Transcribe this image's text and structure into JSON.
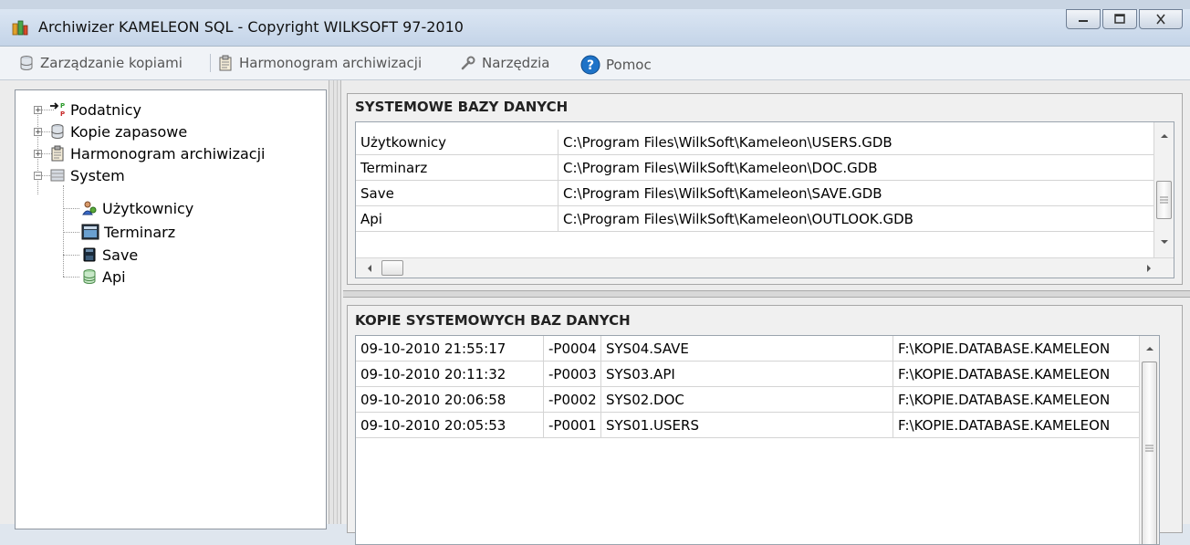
{
  "window": {
    "title": "Archiwizer KAMELEON SQL - Copyright WILKSOFT 97-2010"
  },
  "menu": {
    "items": [
      {
        "label": "Zarządzanie kopiami",
        "icon": "database-icon"
      },
      {
        "label": "Harmonogram archiwizacji",
        "icon": "clipboard-icon"
      },
      {
        "label": "Narzędzia",
        "icon": "wrench-icon"
      },
      {
        "label": "Pomoc",
        "icon": "help-icon"
      }
    ]
  },
  "tree": {
    "nodes": [
      {
        "label": "Podatnicy",
        "icon": "arrows-icon",
        "expander": "+"
      },
      {
        "label": "Kopie zapasowe",
        "icon": "database-icon",
        "expander": "+"
      },
      {
        "label": "Harmonogram archiwizacji",
        "icon": "clipboard-icon",
        "expander": "+"
      },
      {
        "label": "System",
        "icon": "server-icon",
        "expander": "−"
      },
      {
        "label": "Użytkownicy",
        "icon": "users-icon"
      },
      {
        "label": "Terminarz",
        "icon": "calendar-icon"
      },
      {
        "label": "Save",
        "icon": "save-icon"
      },
      {
        "label": "Api",
        "icon": "cylinder-icon"
      }
    ]
  },
  "system_db": {
    "header": "SYSTEMOWE BAZY DANYCH",
    "rows": [
      [
        "Użytkownicy",
        "C:\\Program Files\\WilkSoft\\Kameleon\\USERS.GDB"
      ],
      [
        "Terminarz",
        "C:\\Program Files\\WilkSoft\\Kameleon\\DOC.GDB"
      ],
      [
        "Save",
        "C:\\Program Files\\WilkSoft\\Kameleon\\SAVE.GDB"
      ],
      [
        "Api",
        "C:\\Program Files\\WilkSoft\\Kameleon\\OUTLOOK.GDB"
      ]
    ]
  },
  "copies": {
    "header": "KOPIE SYSTEMOWYCH BAZ DANYCH",
    "rows": [
      [
        "09-10-2010 21:55:17",
        "-P0004",
        "SYS04.SAVE",
        "F:\\KOPIE.DATABASE.KAMELEON"
      ],
      [
        "09-10-2010 20:11:32",
        "-P0003",
        "SYS03.API",
        "F:\\KOPIE.DATABASE.KAMELEON"
      ],
      [
        "09-10-2010 20:06:58",
        "-P0002",
        "SYS02.DOC",
        "F:\\KOPIE.DATABASE.KAMELEON"
      ],
      [
        "09-10-2010 20:05:53",
        "-P0001",
        "SYS01.USERS",
        "F:\\KOPIE.DATABASE.KAMELEON"
      ]
    ]
  },
  "colors": {
    "titlebar": "#c4d4e8",
    "help_icon": "#1e73c8"
  }
}
